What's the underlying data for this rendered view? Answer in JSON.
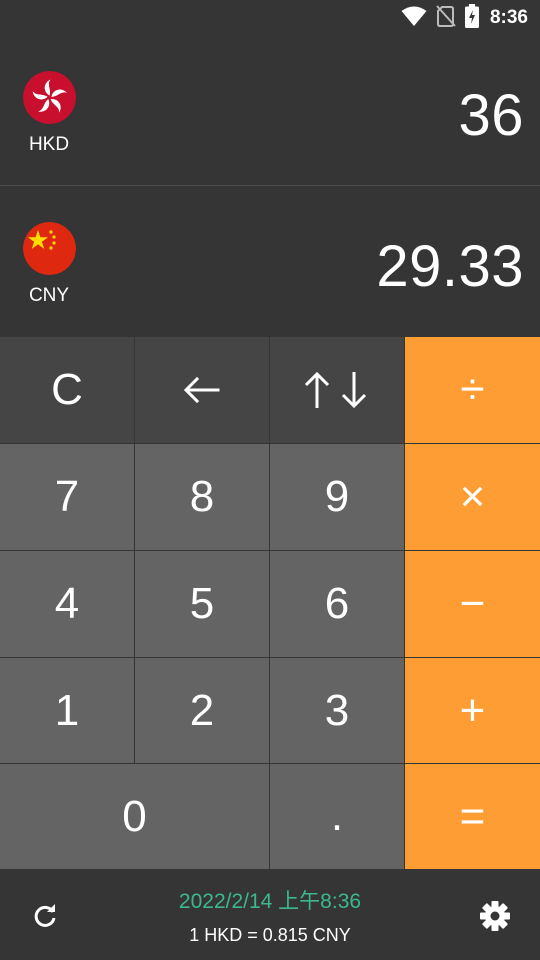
{
  "status_bar": {
    "time": "8:36",
    "icons": [
      "wifi-icon",
      "no-sim-icon",
      "battery-charging-icon"
    ]
  },
  "converter": {
    "from": {
      "code": "HKD",
      "flag": "hong-kong-flag-icon",
      "amount": "36"
    },
    "to": {
      "code": "CNY",
      "flag": "china-flag-icon",
      "amount": "29.33"
    }
  },
  "keypad": {
    "clear": "C",
    "backspace_icon": "backspace-arrow-icon",
    "swap_icon": "swap-arrows-icon",
    "divide": "÷",
    "multiply": "×",
    "subtract": "−",
    "add": "+",
    "equals": "=",
    "decimal": ".",
    "digits": [
      "0",
      "1",
      "2",
      "3",
      "4",
      "5",
      "6",
      "7",
      "8",
      "9"
    ]
  },
  "footer": {
    "updated": "2022/2/14 上午8:36",
    "rate": "1 HKD = 0.815 CNY",
    "refresh_icon": "refresh-icon",
    "settings_icon": "gear-icon"
  },
  "colors": {
    "background": "#353535",
    "function_key": "#454545",
    "number_key": "#646464",
    "operator_key": "#ff9d35",
    "timestamp": "#3cb88c"
  }
}
